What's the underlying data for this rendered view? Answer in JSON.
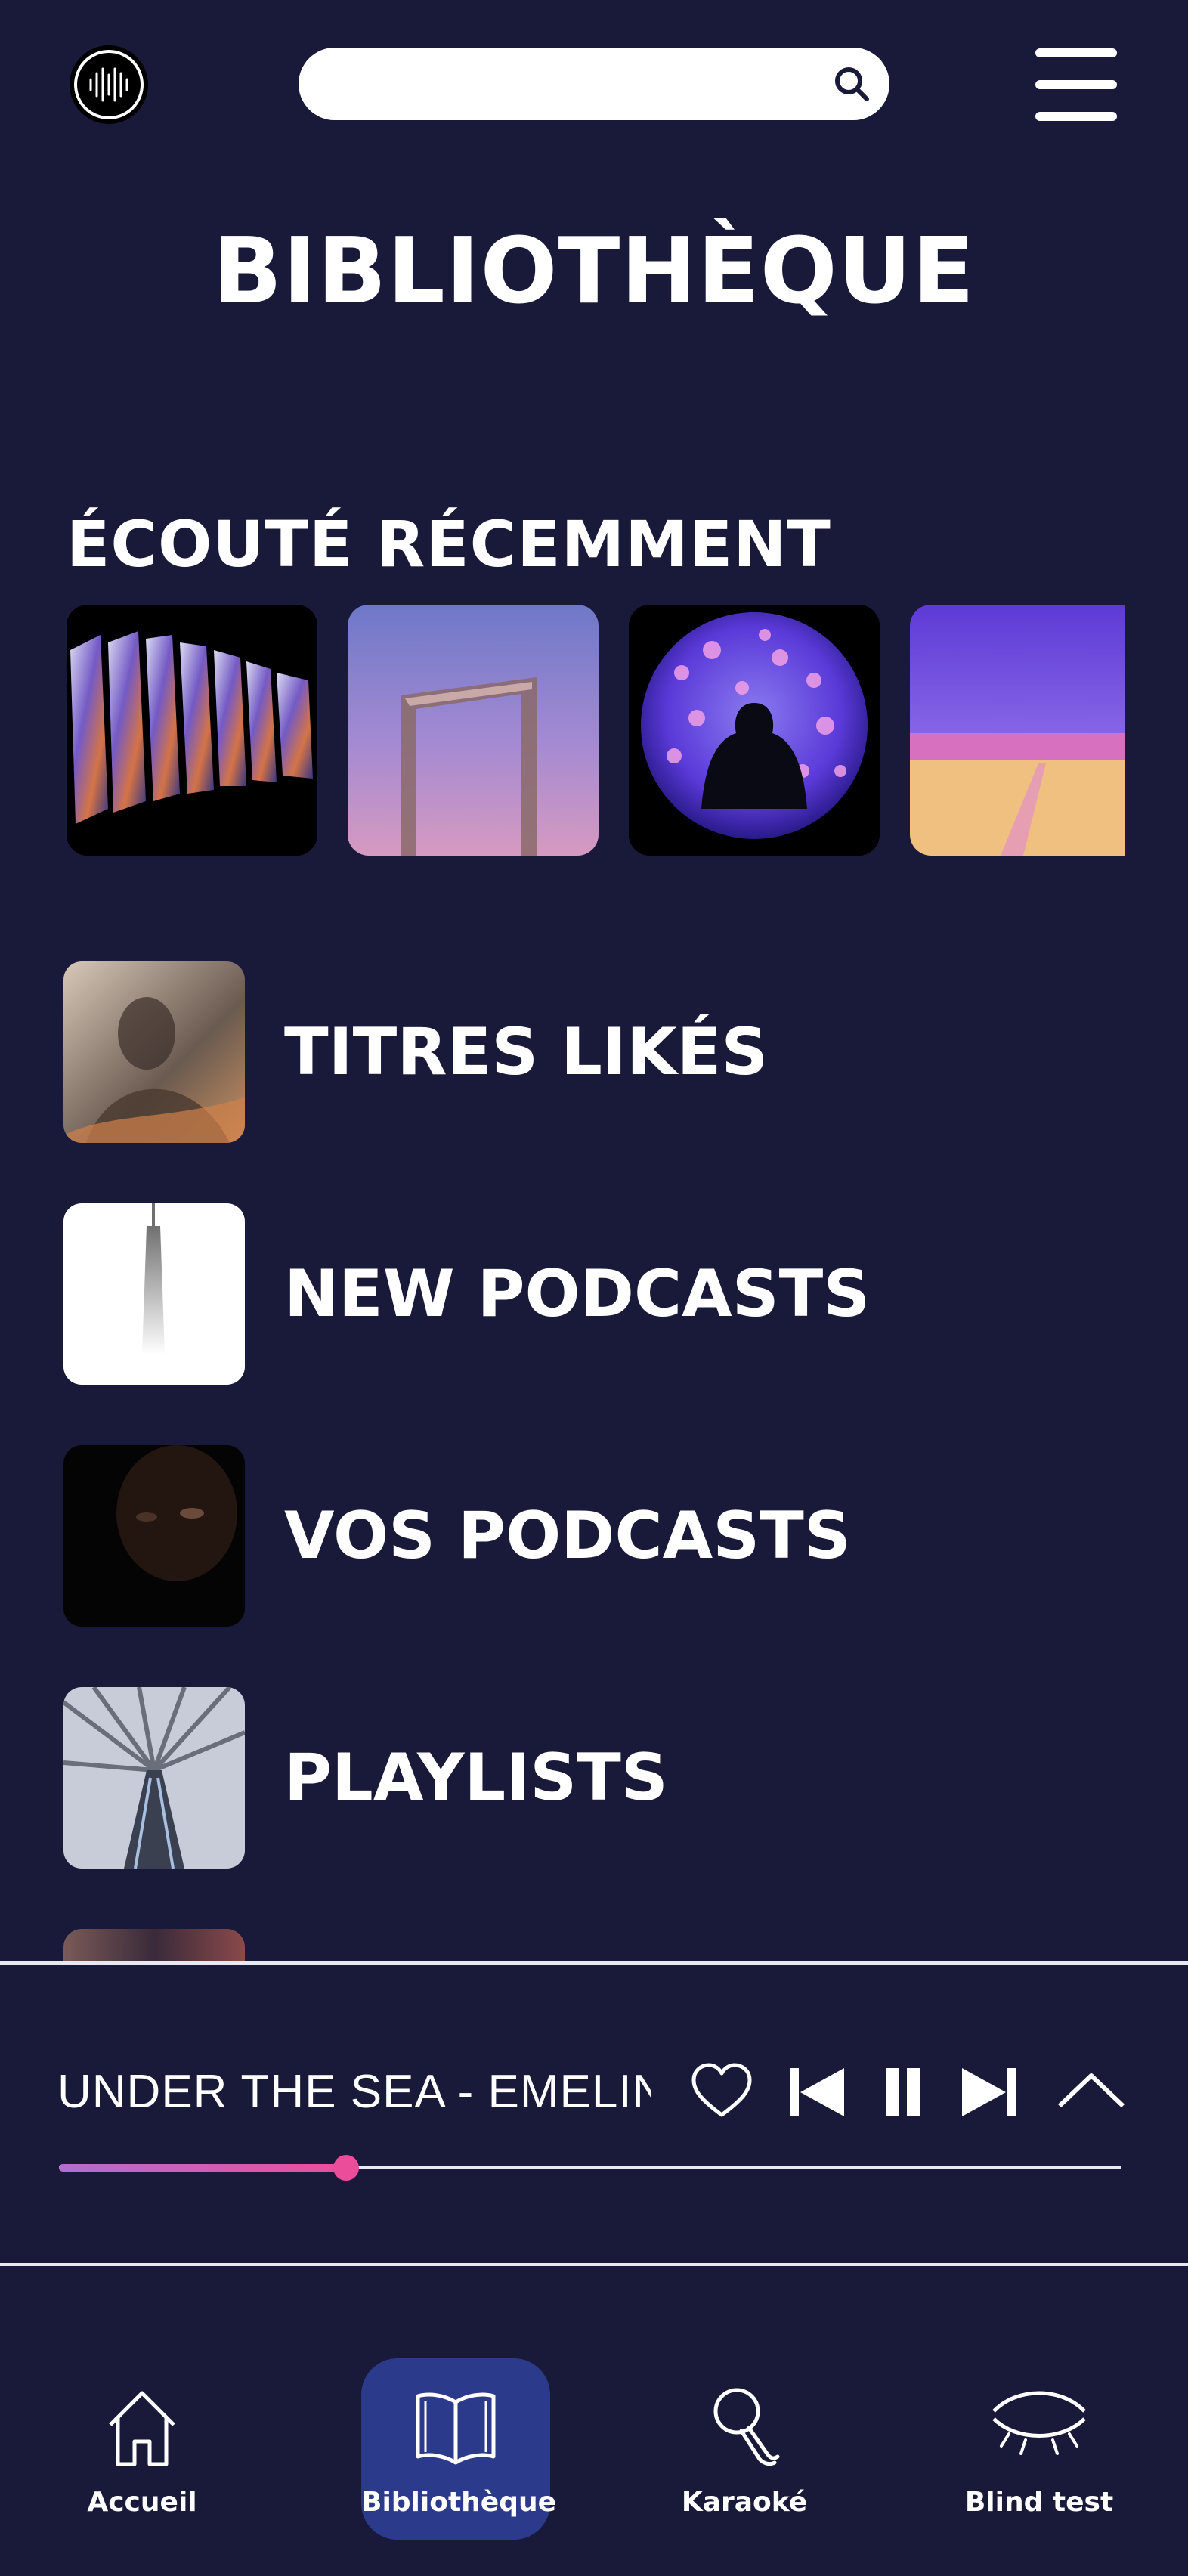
{
  "header": {
    "search_placeholder": "",
    "logo_icon": "soundwave-icon",
    "search_icon": "search-icon",
    "menu_icon": "hamburger-menu-icon"
  },
  "page": {
    "title": "BIBLIOTHÈQUE"
  },
  "recent": {
    "title": "ÉCOUTÉ RÉCEMMENT",
    "items": [
      {
        "image": "glass-prisms-artwork"
      },
      {
        "image": "frame-tower-artwork"
      },
      {
        "image": "aquarium-jellyfish-artwork"
      },
      {
        "image": "pink-field-artwork"
      }
    ]
  },
  "library": {
    "items": [
      {
        "label": "TITRES LIKÉS",
        "image": "portrait-artwork"
      },
      {
        "label": "NEW PODCASTS",
        "image": "skyscraper-artwork"
      },
      {
        "label": "VOS PODCASTS",
        "image": "dark-face-artwork"
      },
      {
        "label": "PLAYLISTS",
        "image": "escalator-artwork"
      }
    ]
  },
  "player": {
    "track": "UNDER THE SEA - EMELINE",
    "progress": 0.27,
    "icons": [
      "heart-icon",
      "skip-back-icon",
      "pause-icon",
      "skip-forward-icon",
      "chevron-up-icon"
    ]
  },
  "nav": {
    "items": [
      {
        "label": "Accueil",
        "icon": "home-icon"
      },
      {
        "label": "Bibliothèque",
        "icon": "book-icon",
        "active": true
      },
      {
        "label": "Karaoké",
        "icon": "microphone-icon"
      },
      {
        "label": "Blind test",
        "icon": "closed-eye-icon"
      }
    ]
  },
  "colors": {
    "background": "#191a3a",
    "accent": "#ec4d9a",
    "nav_active": "#2b3a8a",
    "text": "#ffffff"
  }
}
